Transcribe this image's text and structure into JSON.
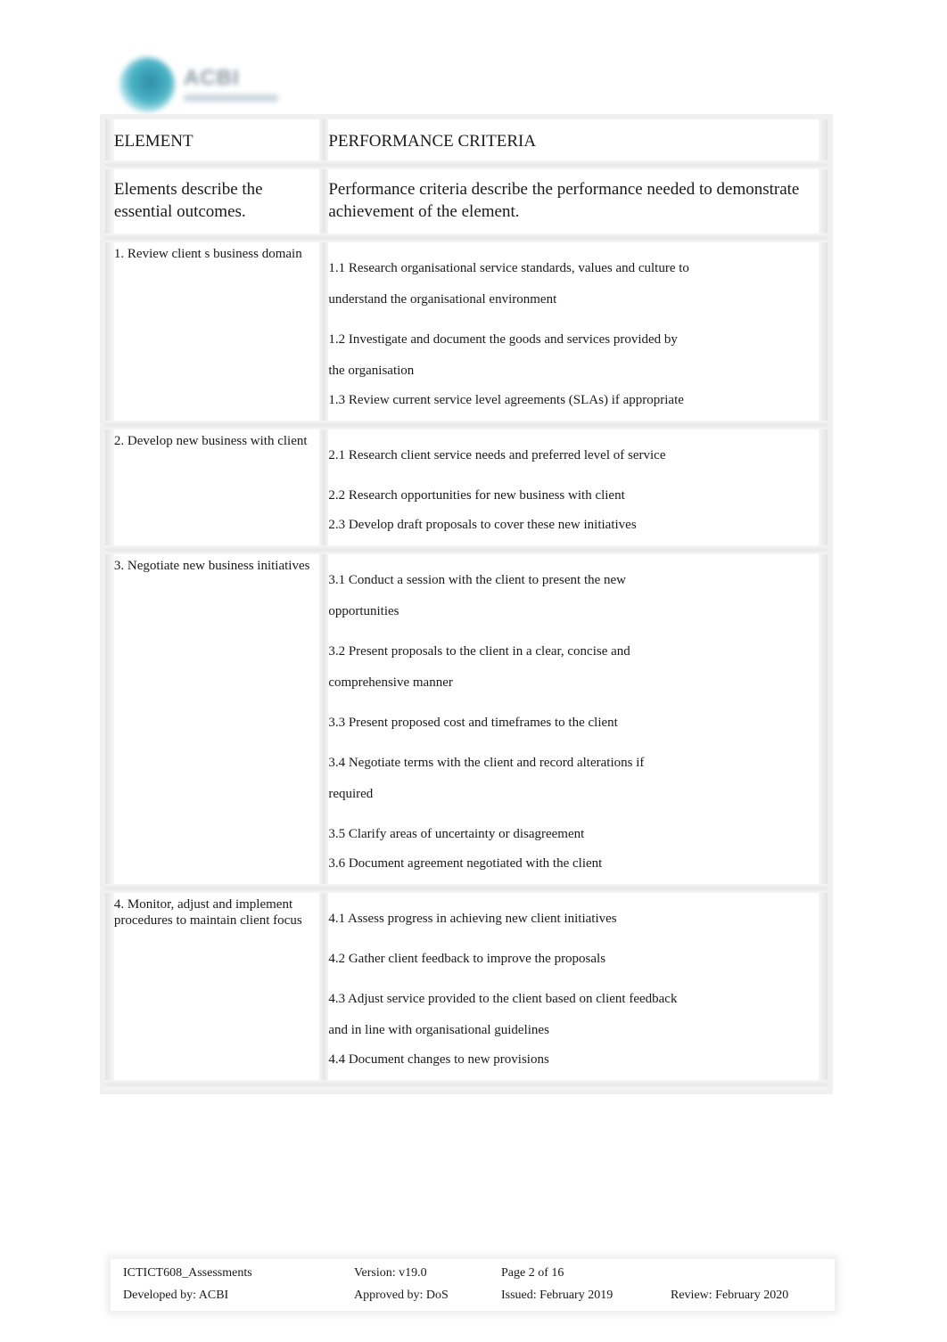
{
  "logo": {
    "name": "ACBI",
    "subtitle": ""
  },
  "table": {
    "header": {
      "element_title": "ELEMENT",
      "criteria_title": "PERFORMANCE CRITERIA",
      "element_desc": "Elements describe the essential outcomes.",
      "criteria_desc": "Performance criteria describe the performance needed to demonstrate achievement of the element."
    },
    "rows": [
      {
        "element": " 1. Review client s business domain",
        "criteria": [
          "1.1 Research organisational service standards, values and culture to",
          "understand the organisational environment",
          "1.2 Investigate and document the goods and services provided by",
          "the organisation",
          "1.3 Review current service level agreements (SLAs) if appropriate"
        ]
      },
      {
        "element": "2. Develop new business with client",
        "criteria": [
          "2.1 Research client service needs and preferred level of service",
          "2.2 Research opportunities for new business with client",
          "2.3 Develop draft proposals to cover these new initiatives"
        ]
      },
      {
        "element": "3. Negotiate new business initiatives",
        "criteria": [
          "3.1 Conduct a session with the client to present the new",
          "opportunities",
          "3.2 Present proposals to the client in a clear, concise and",
          "comprehensive manner",
          "3.3 Present proposed cost and timeframes to the client",
          "3.4 Negotiate terms with the client and record alterations if",
          "required",
          "3.5 Clarify areas of uncertainty or disagreement",
          "3.6 Document agreement negotiated with the client"
        ]
      },
      {
        "element": "4. Monitor, adjust and implement procedures to maintain client focus",
        "criteria": [
          "4.1 Assess progress in achieving new client initiatives",
          "4.2 Gather client feedback to improve the proposals",
          "4.3 Adjust service provided to the client based on client feedback",
          "and in line with organisational guidelines",
          "4.4 Document changes to new provisions"
        ]
      }
    ]
  },
  "footer": {
    "doc_code": "ICTICT608_Assessments",
    "version": "Version: v19.0",
    "page": "Page 2 of 16",
    "developed_by": "Developed by: ACBI",
    "approved_by": "Approved by: DoS",
    "issued": "Issued: February 2019",
    "review": "Review:  February 2020"
  }
}
